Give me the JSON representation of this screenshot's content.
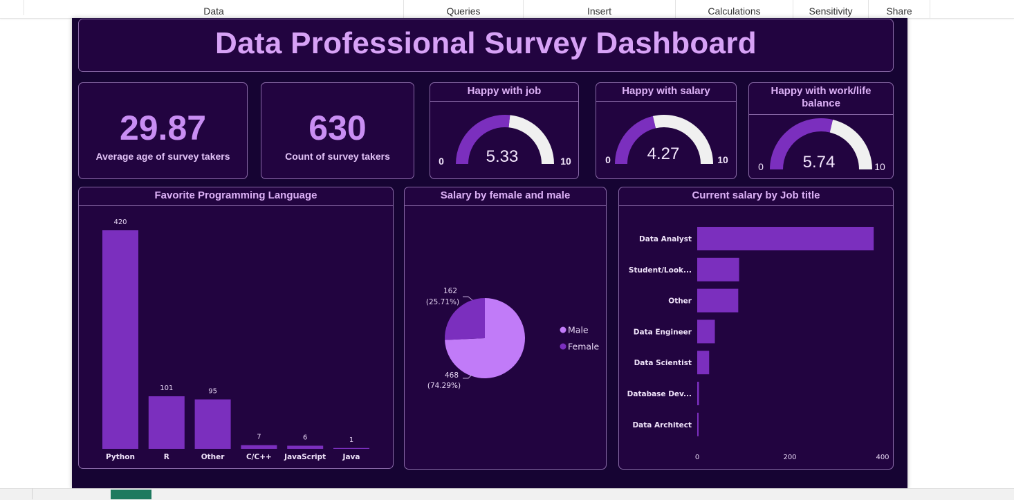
{
  "ribbon": {
    "tabs": [
      {
        "label": "Data"
      },
      {
        "label": "Queries"
      },
      {
        "label": "Insert"
      },
      {
        "label": "Calculations"
      },
      {
        "label": "Sensitivity"
      },
      {
        "label": "Share"
      }
    ]
  },
  "dashboard": {
    "title": "Data Professional Survey Dashboard",
    "colors": {
      "background": "#160433",
      "card": "#220440",
      "border": "#8a6aa8",
      "accent": "#7b2fbe",
      "light": "#c17bf8",
      "track": "#f0f0f0"
    },
    "kpis": [
      {
        "value": "29.87",
        "label": "Average age of survey takers"
      },
      {
        "value": "630",
        "label": "Count of survey takers"
      }
    ],
    "gauges": [
      {
        "title": "Happy with job",
        "value": 5.33,
        "value_text": "5.33",
        "min_text": "0",
        "max_text": "10",
        "min": 0,
        "max": 10
      },
      {
        "title": "Happy with salary",
        "value": 4.27,
        "value_text": "4.27",
        "min_text": "0",
        "max_text": "10",
        "min": 0,
        "max": 10
      },
      {
        "title": "Happy with work/life balance",
        "value": 5.74,
        "value_text": "5.74",
        "min_text": "0",
        "max_text": "10",
        "min": 0,
        "max": 10
      }
    ],
    "charts": {
      "languages_title": "Favorite Programming Language",
      "gender_title": "Salary by female and male",
      "jobs_title": "Current salary by Job title"
    }
  },
  "chart_data": [
    {
      "type": "bar",
      "title": "Favorite Programming Language",
      "categories": [
        "Python",
        "R",
        "Other",
        "C/C++",
        "JavaScript",
        "Java"
      ],
      "values": [
        420,
        101,
        95,
        7,
        6,
        1
      ],
      "data_labels": [
        "420",
        "101",
        "95",
        "7",
        "6",
        "1"
      ],
      "ylim": [
        0,
        420
      ]
    },
    {
      "type": "pie",
      "title": "Salary by female and male",
      "categories": [
        "Male",
        "Female"
      ],
      "values": [
        468,
        162
      ],
      "labels": [
        {
          "count": "468",
          "pct": "(74.29%)"
        },
        {
          "count": "162",
          "pct": "(25.71%)"
        }
      ],
      "legend": "right"
    },
    {
      "type": "bar",
      "orientation": "horizontal",
      "title": "Current salary by Job title",
      "categories": [
        "Data Analyst",
        "Student/Look...",
        "Other",
        "Data Engineer",
        "Data Scientist",
        "Database Dev...",
        "Data Architect"
      ],
      "values": [
        400,
        95,
        93,
        40,
        27,
        4,
        3
      ],
      "x_ticks": [
        "0",
        "200",
        "400"
      ],
      "xlim": [
        0,
        440
      ]
    }
  ]
}
